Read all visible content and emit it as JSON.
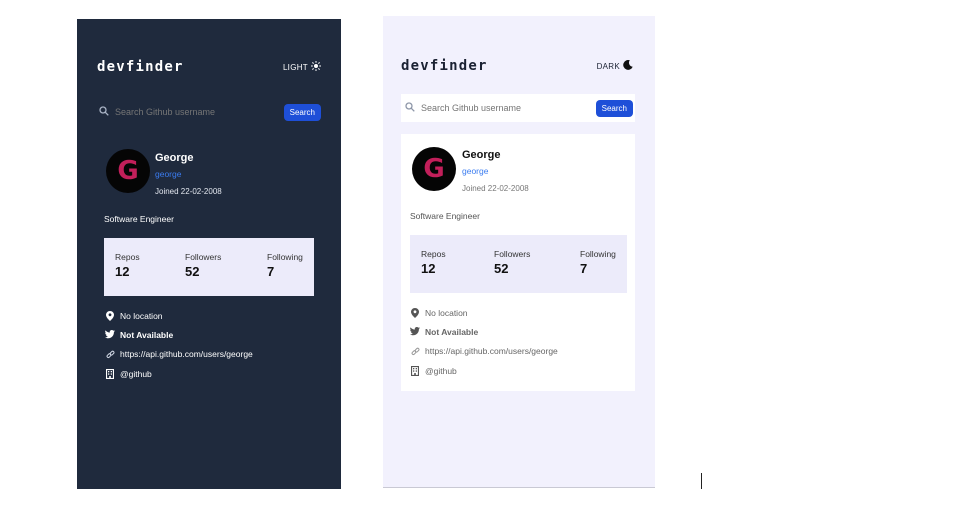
{
  "dark": {
    "logo": "devfinder",
    "theme_toggle": "LIGHT",
    "theme_icon": "sun-icon",
    "search": {
      "placeholder": "Search Github username",
      "button": "Search"
    },
    "profile": {
      "avatar_letter": "G",
      "name": "George",
      "login": "george",
      "joined": "Joined 22-02-2008",
      "bio": "Software Engineer"
    },
    "stats": [
      {
        "label": "Repos",
        "value": "12"
      },
      {
        "label": "Followers",
        "value": "52"
      },
      {
        "label": "Following",
        "value": "7"
      }
    ],
    "links": [
      {
        "icon": "location-pin-icon",
        "text": "No location"
      },
      {
        "icon": "twitter-icon",
        "text": "Not Available"
      },
      {
        "icon": "link-icon",
        "text": "https://api.github.com/users/george"
      },
      {
        "icon": "building-icon",
        "text": "@github"
      }
    ]
  },
  "light": {
    "logo": "devfinder",
    "theme_toggle": "DARK",
    "theme_icon": "moon-icon",
    "search": {
      "placeholder": "Search Github username",
      "button": "Search"
    },
    "profile": {
      "avatar_letter": "G",
      "name": "George",
      "login": "george",
      "joined": "Joined 22-02-2008",
      "bio": "Software Engineer"
    },
    "stats": [
      {
        "label": "Repos",
        "value": "12"
      },
      {
        "label": "Followers",
        "value": "52"
      },
      {
        "label": "Following",
        "value": "7"
      }
    ],
    "links": [
      {
        "icon": "location-pin-icon",
        "text": "No location"
      },
      {
        "icon": "twitter-icon",
        "text": "Not Available"
      },
      {
        "icon": "link-icon",
        "text": "https://api.github.com/users/george"
      },
      {
        "icon": "building-icon",
        "text": "@github"
      }
    ]
  },
  "colors": {
    "dark_bg": "#1f2a3d",
    "light_bg": "#f2f1fd",
    "accent": "#1e4fd8",
    "login_link": "#3b7cf0",
    "avatar_letter": "#c21f5a"
  }
}
